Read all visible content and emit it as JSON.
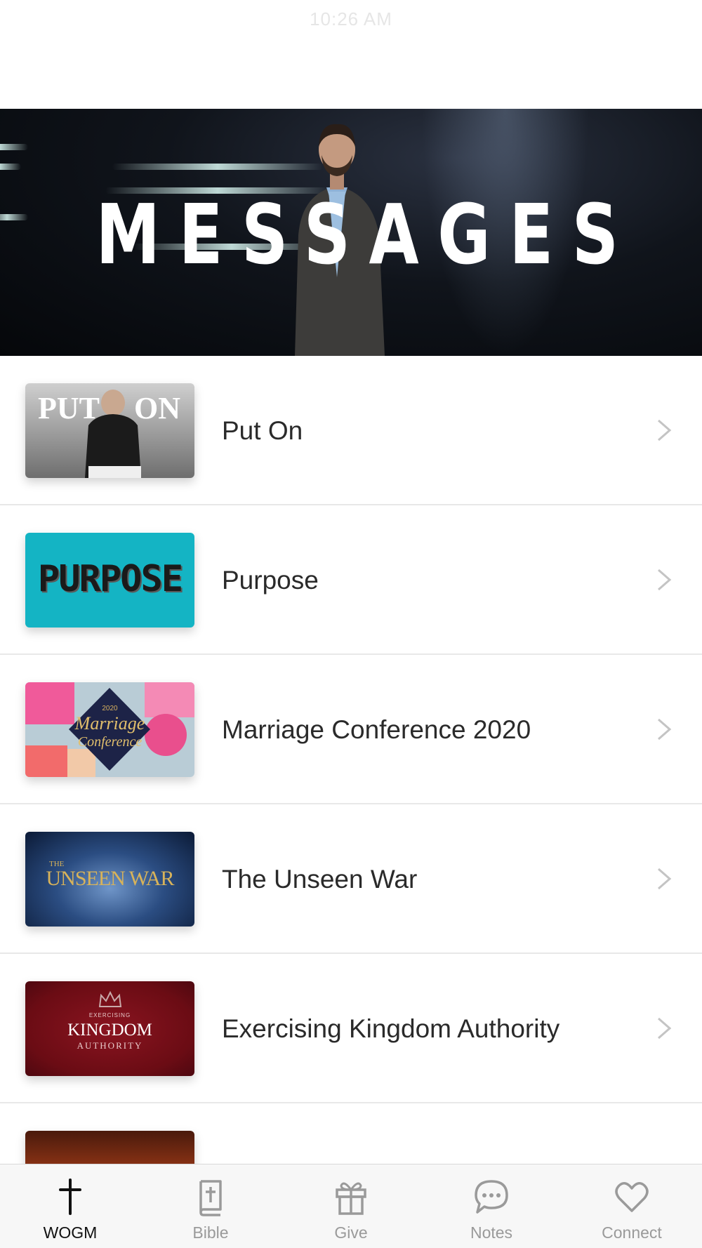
{
  "status_bar": {
    "time": "10:26 AM"
  },
  "hero": {
    "title": "MESSAGES"
  },
  "messages": [
    {
      "title": "Put On",
      "thumb_text": [
        "PUT",
        "ON"
      ]
    },
    {
      "title": "Purpose",
      "thumb_text": [
        "PURPOSE"
      ]
    },
    {
      "title": "Marriage Conference 2020",
      "thumb_text": [
        "2020",
        "Marriage",
        "Conference"
      ]
    },
    {
      "title": "The Unseen War",
      "thumb_text": [
        "THE",
        "UNSEEN WAR"
      ]
    },
    {
      "title": "Exercising Kingdom Authority",
      "thumb_text": [
        "EXERCISING",
        "KINGDOM",
        "AUTHORITY"
      ]
    }
  ],
  "tabbar": {
    "items": [
      {
        "label": "WOGM",
        "icon": "cross-icon",
        "active": true
      },
      {
        "label": "Bible",
        "icon": "bible-icon",
        "active": false
      },
      {
        "label": "Give",
        "icon": "gift-icon",
        "active": false
      },
      {
        "label": "Notes",
        "icon": "chat-bubble-icon",
        "active": false
      },
      {
        "label": "Connect",
        "icon": "heart-icon",
        "active": false
      }
    ]
  },
  "colors": {
    "accent": "#111111",
    "inactive": "#9a9a9a",
    "chevron": "#c4c4c4"
  }
}
